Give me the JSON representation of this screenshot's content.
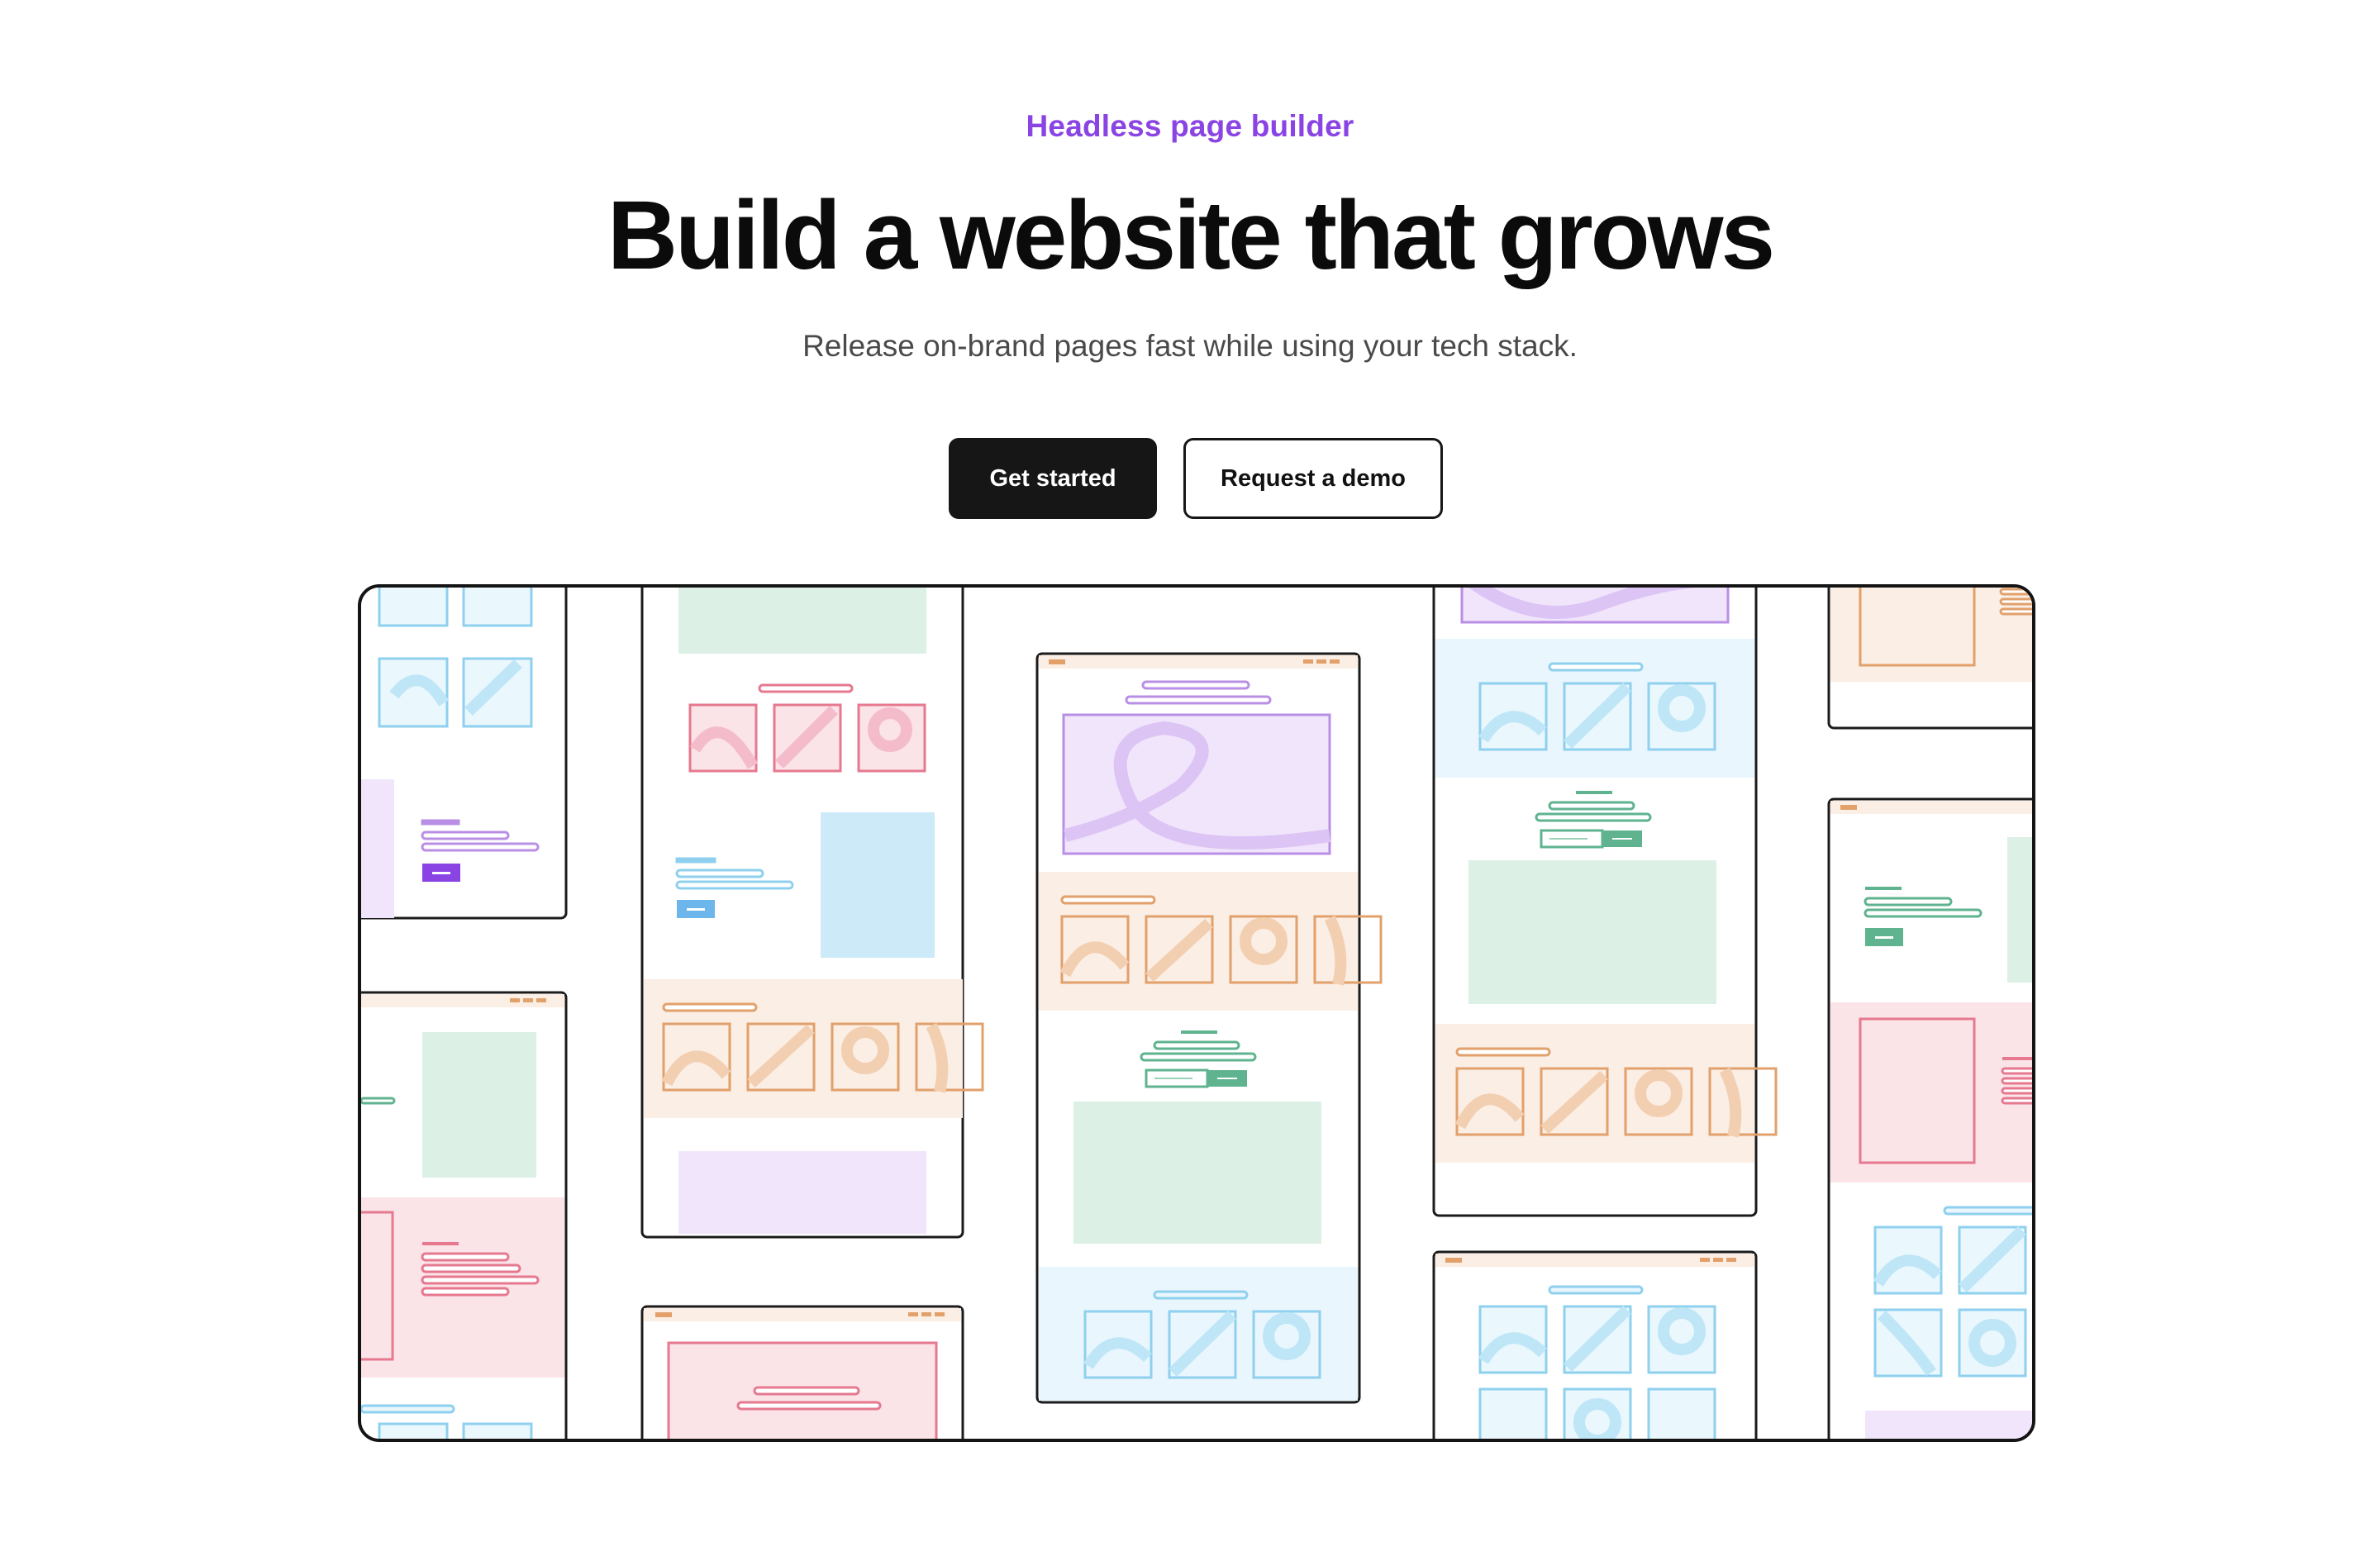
{
  "hero": {
    "eyebrow": "Headless page builder",
    "title": "Build a website that grows",
    "subtitle": "Release on-brand pages fast while using your tech stack."
  },
  "actions": {
    "primary_label": "Get started",
    "secondary_label": "Request a demo"
  },
  "colors": {
    "accent": "#8a44e4",
    "button_dark": "#161616",
    "wire_blue": "#8fd0ee",
    "wire_green": "#5fb38f",
    "wire_orange": "#e2a06b",
    "wire_pink": "#e6788f",
    "wire_purple": "#b98fe6"
  },
  "illustration": {
    "name": "page-layout-wireframes"
  }
}
